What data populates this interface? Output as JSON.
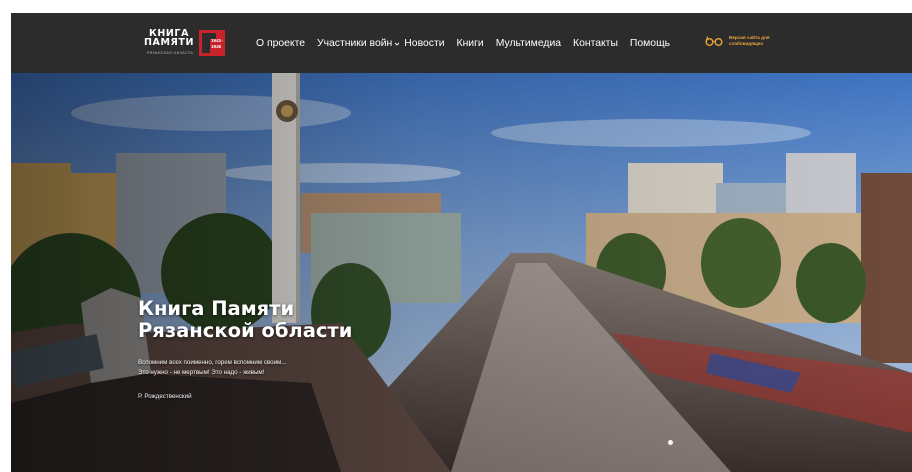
{
  "header": {
    "logo": {
      "line1": "КНИГА",
      "line2": "ПАМЯТИ",
      "region": "РЯЗАНСКАЯ ОБЛАСТЬ",
      "year_start": "1941-",
      "year_end": "1945"
    },
    "nav": [
      {
        "label": "О проекте",
        "dropdown": false
      },
      {
        "label": "Участники войн",
        "dropdown": true
      },
      {
        "label": "Новости",
        "dropdown": false
      },
      {
        "label": "Книги",
        "dropdown": false
      },
      {
        "label": "Мультимедиа",
        "dropdown": false
      },
      {
        "label": "Контакты",
        "dropdown": false
      },
      {
        "label": "Помощь",
        "dropdown": false
      }
    ],
    "accessibility": {
      "icon": "glasses-icon",
      "label": "Версия сайта для слабовидящих"
    }
  },
  "hero": {
    "title_line1": "Книга Памяти",
    "title_line2": "Рязанской области",
    "quote_line1": "Вспомним всех поименно, горем вспомним своим...",
    "quote_line2": "Это нужно - не мертвым! Это надо - живым!",
    "author": "Р. Рождественский",
    "slides_total": 2,
    "slide_active": 1
  },
  "colors": {
    "header_bg": "#2c2c2c",
    "accent_red": "#c8232c",
    "accessibility_text": "#e9a53b"
  }
}
